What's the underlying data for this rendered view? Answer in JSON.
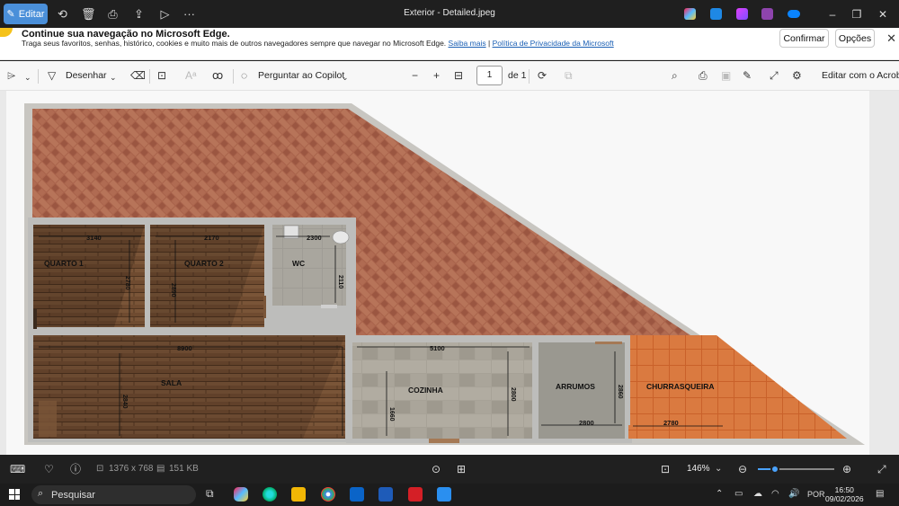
{
  "titlebar": {
    "edit_label": "Editar",
    "window_title": "Exterior - Detailed.jpeg",
    "more_glyph": "···"
  },
  "infobar": {
    "heading": "Continue sua navegação no Microsoft Edge.",
    "text": "Traga seus favoritos, senhas, histórico, cookies e muito mais de outros navegadores sempre que navegar no Microsoft Edge.",
    "link_learn_more": "Saiba mais",
    "separator": "|",
    "link_privacy": "Política de Privacidade da Microsoft",
    "confirm_label": "Confirmar",
    "options_label": "Opções"
  },
  "toolbar": {
    "draw_label": "Desenhar",
    "copilot_label": "Perguntar ao Copilot",
    "page_current": "1",
    "page_total": "de 1",
    "edit_acrobat_label": "Editar com o Acrobat"
  },
  "plan": {
    "rooms": {
      "quarto1": "QUARTO 1",
      "quarto2": "QUARTO 2",
      "wc": "WC",
      "sala": "SALA",
      "cozinha": "COZINHA",
      "arrumos": "ARRUMOS",
      "churrasqueira": "CHURRASQUEIRA"
    },
    "dims": {
      "q1_width": "3140",
      "q2_width": "2170",
      "wc_width": "2300",
      "wc_height": "2110",
      "q1_height": "2780",
      "q2_height": "2890",
      "sala_width": "8900",
      "sala_height": "2840",
      "cozinha_width": "5100",
      "cozinha_h1": "1660",
      "cozinha_h2": "2800",
      "arrumos_width": "2800",
      "arrumos_height": "2860",
      "churr_width": "2780"
    }
  },
  "statusbar": {
    "dimensions": "1376 x 768",
    "file_size": "151 KB",
    "zoom_level": "146%",
    "zoom_fraction": 0.22
  },
  "taskbar": {
    "search_placeholder": "Pesquisar",
    "language": "POR",
    "time": "16:50",
    "date": "09/02/2026"
  },
  "colors": {
    "accent": "#4a8fd9",
    "brick": "#a8624a",
    "wood": "#6b4a30",
    "tile": "#d9793d",
    "wall": "#bdbdbb"
  }
}
